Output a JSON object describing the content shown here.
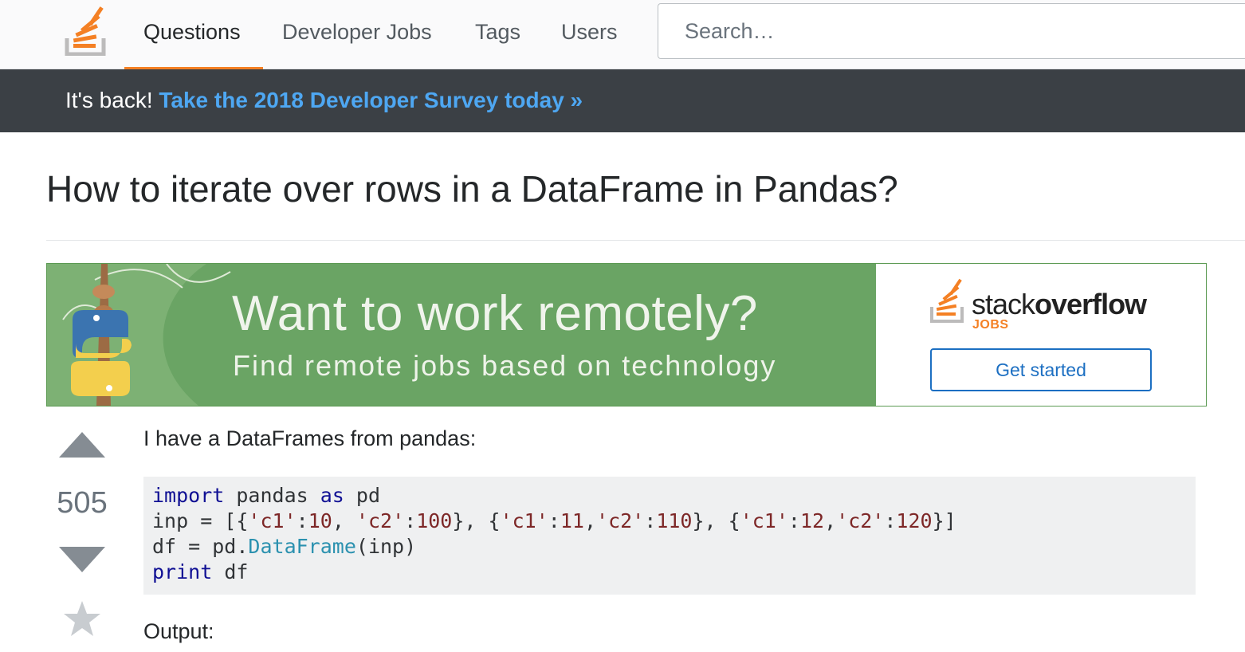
{
  "nav": {
    "logo_icon": "stackoverflow-logo-icon",
    "items": [
      {
        "label": "Questions",
        "active": true
      },
      {
        "label": "Developer Jobs",
        "active": false
      },
      {
        "label": "Tags",
        "active": false
      },
      {
        "label": "Users",
        "active": false
      }
    ],
    "search_placeholder": "Search…",
    "accent_color": "#f48024"
  },
  "announcement": {
    "prefix": "It's back!",
    "link_text": "Take the 2018 Developer Survey today »"
  },
  "question": {
    "title": "How to iterate over rows in a DataFrame in Pandas?",
    "votes": "505",
    "body_intro": "I have a DataFrames from pandas:",
    "code_lines": [
      [
        {
          "t": "import",
          "c": "kw"
        },
        {
          "t": " pandas ",
          "c": ""
        },
        {
          "t": "as",
          "c": "kw"
        },
        {
          "t": " pd",
          "c": ""
        }
      ],
      [
        {
          "t": "inp = [{",
          "c": ""
        },
        {
          "t": "'c1'",
          "c": "str"
        },
        {
          "t": ":",
          "c": ""
        },
        {
          "t": "10",
          "c": "str"
        },
        {
          "t": ", ",
          "c": ""
        },
        {
          "t": "'c2'",
          "c": "str"
        },
        {
          "t": ":",
          "c": ""
        },
        {
          "t": "100",
          "c": "str"
        },
        {
          "t": "}, {",
          "c": ""
        },
        {
          "t": "'c1'",
          "c": "str"
        },
        {
          "t": ":",
          "c": ""
        },
        {
          "t": "11",
          "c": "str"
        },
        {
          "t": ",",
          "c": ""
        },
        {
          "t": "'c2'",
          "c": "str"
        },
        {
          "t": ":",
          "c": ""
        },
        {
          "t": "110",
          "c": "str"
        },
        {
          "t": "}, {",
          "c": ""
        },
        {
          "t": "'c1'",
          "c": "str"
        },
        {
          "t": ":",
          "c": ""
        },
        {
          "t": "12",
          "c": "str"
        },
        {
          "t": ",",
          "c": ""
        },
        {
          "t": "'c2'",
          "c": "str"
        },
        {
          "t": ":",
          "c": ""
        },
        {
          "t": "120",
          "c": "str"
        },
        {
          "t": "}]",
          "c": ""
        }
      ],
      [
        {
          "t": "df = pd.",
          "c": ""
        },
        {
          "t": "DataFrame",
          "c": "typ"
        },
        {
          "t": "(inp)",
          "c": ""
        }
      ],
      [
        {
          "t": "print",
          "c": "kw"
        },
        {
          "t": " df",
          "c": ""
        }
      ]
    ],
    "output_label": "Output:"
  },
  "ad": {
    "headline": "Want to work remotely?",
    "subline": "Find remote jobs based on technology",
    "brand_light": "stack",
    "brand_bold": "overflow",
    "brand_sub": "JOBS",
    "cta": "Get started",
    "bg_color": "#6aa464"
  },
  "icons": {
    "vote_up": "arrow-up-icon",
    "vote_down": "arrow-down-icon",
    "favorite": "star-icon"
  }
}
